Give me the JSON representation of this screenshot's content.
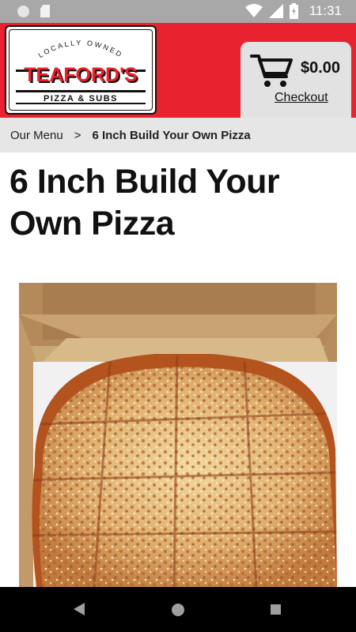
{
  "status_bar": {
    "time": "11:31",
    "icons": [
      "notification-circle-icon",
      "sd-card-icon",
      "wifi-icon",
      "cell-signal-icon",
      "battery-charging-icon"
    ]
  },
  "header": {
    "brand_color": "#e8222e",
    "logo": {
      "tagline": "LOCALLY OWNED",
      "name": "TEAFORD'S",
      "sub": "PIZZA & SUBS"
    },
    "cart": {
      "icon": "shopping-cart-icon",
      "total": "$0.00",
      "checkout_label": "Checkout"
    }
  },
  "breadcrumb": {
    "parent": "Our Menu",
    "separator": ">",
    "current": "6 Inch Build Your Own Pizza"
  },
  "product": {
    "title": "6 Inch Build Your Own Pizza",
    "image_alt": "pizza in box"
  },
  "nav_bar": {
    "icons": [
      "back-icon",
      "home-icon",
      "recents-icon"
    ]
  }
}
